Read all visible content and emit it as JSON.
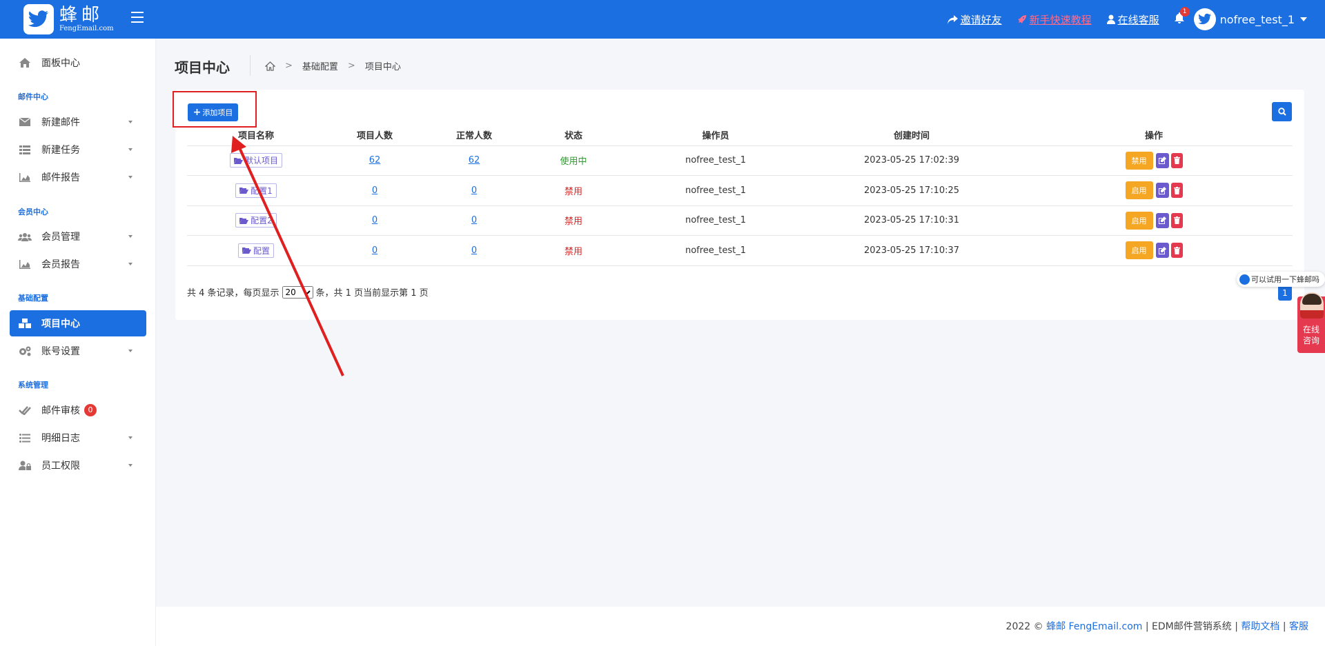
{
  "header": {
    "logo_cn": "蜂邮",
    "logo_en": "FengEmail.com",
    "invite_label": "邀请好友",
    "tutorial_label": "新手快速教程",
    "service_label": "在线客服",
    "bell_count": "1",
    "username": "nofree_test_1"
  },
  "sidebar": {
    "dashboard": "面板中心",
    "sec_mail": "邮件中心",
    "new_mail": "新建邮件",
    "new_task": "新建任务",
    "mail_report": "邮件报告",
    "sec_member": "会员中心",
    "member_mgmt": "会员管理",
    "member_report": "会员报告",
    "sec_basic": "基础配置",
    "project_center": "项目中心",
    "account_settings": "账号设置",
    "sec_system": "系统管理",
    "mail_review": "邮件审核",
    "mail_review_badge": "0",
    "detail_log": "明细日志",
    "staff_perm": "员工权限"
  },
  "page": {
    "title": "项目中心",
    "breadcrumb": [
      "基础配置",
      "项目中心"
    ],
    "add_button": "添加项目"
  },
  "table": {
    "headers": [
      "项目名称",
      "项目人数",
      "正常人数",
      "状态",
      "操作员",
      "创建时间",
      "操作"
    ],
    "rows": [
      {
        "name": "默认项目",
        "count": "62",
        "normal": "62",
        "status": "使用中",
        "operator": "nofree_test_1",
        "created": "2023-05-25 17:02:39",
        "toggle": "禁用"
      },
      {
        "name": "配置1",
        "count": "0",
        "normal": "0",
        "status": "禁用",
        "operator": "nofree_test_1",
        "created": "2023-05-25 17:10:25",
        "toggle": "启用"
      },
      {
        "name": "配置2",
        "count": "0",
        "normal": "0",
        "status": "禁用",
        "operator": "nofree_test_1",
        "created": "2023-05-25 17:10:31",
        "toggle": "启用"
      },
      {
        "name": "配置",
        "count": "0",
        "normal": "0",
        "status": "禁用",
        "operator": "nofree_test_1",
        "created": "2023-05-25 17:10:37",
        "toggle": "启用"
      }
    ]
  },
  "pager": {
    "prefix": "共 4 条记录，每页显示",
    "page_size": "20",
    "suffix": "条，共 1 页当前显示第 1 页",
    "current_page": "1"
  },
  "chat": {
    "bubble": "可以试用一下蜂邮吗",
    "side_line1": "在线",
    "side_line2": "咨询"
  },
  "footer": {
    "year": "2022 ©",
    "brand": "蜂邮 FengEmail.com",
    "system": "EDM邮件营销系统",
    "help": "帮助文档",
    "service": "客服"
  },
  "colors": {
    "primary": "#1c6fe0",
    "warning": "#f5a623",
    "danger": "#e53950",
    "success": "#2e9b2e"
  }
}
